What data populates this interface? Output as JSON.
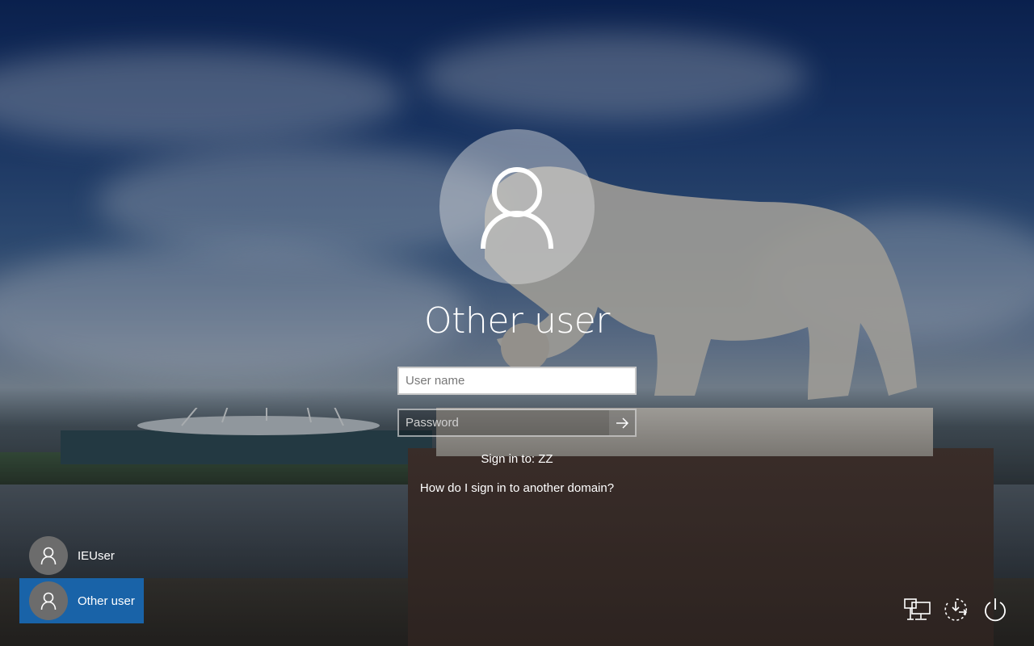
{
  "login": {
    "user_title": "Other user",
    "username_placeholder": "User name",
    "username_value": "",
    "password_placeholder": "Password",
    "password_value": "",
    "sign_in_to": "Sign in to: ZZ",
    "domain_help_link": "How do I sign in to another domain?"
  },
  "users": [
    {
      "name": "IEUser",
      "selected": false
    },
    {
      "name": "Other user",
      "selected": true
    }
  ],
  "corner_icons": [
    {
      "name": "network-icon"
    },
    {
      "name": "ease-of-access-icon"
    },
    {
      "name": "power-icon"
    }
  ],
  "colors": {
    "selected_tile": "#1963a8",
    "avatar_circle": "#e1e1e1"
  }
}
